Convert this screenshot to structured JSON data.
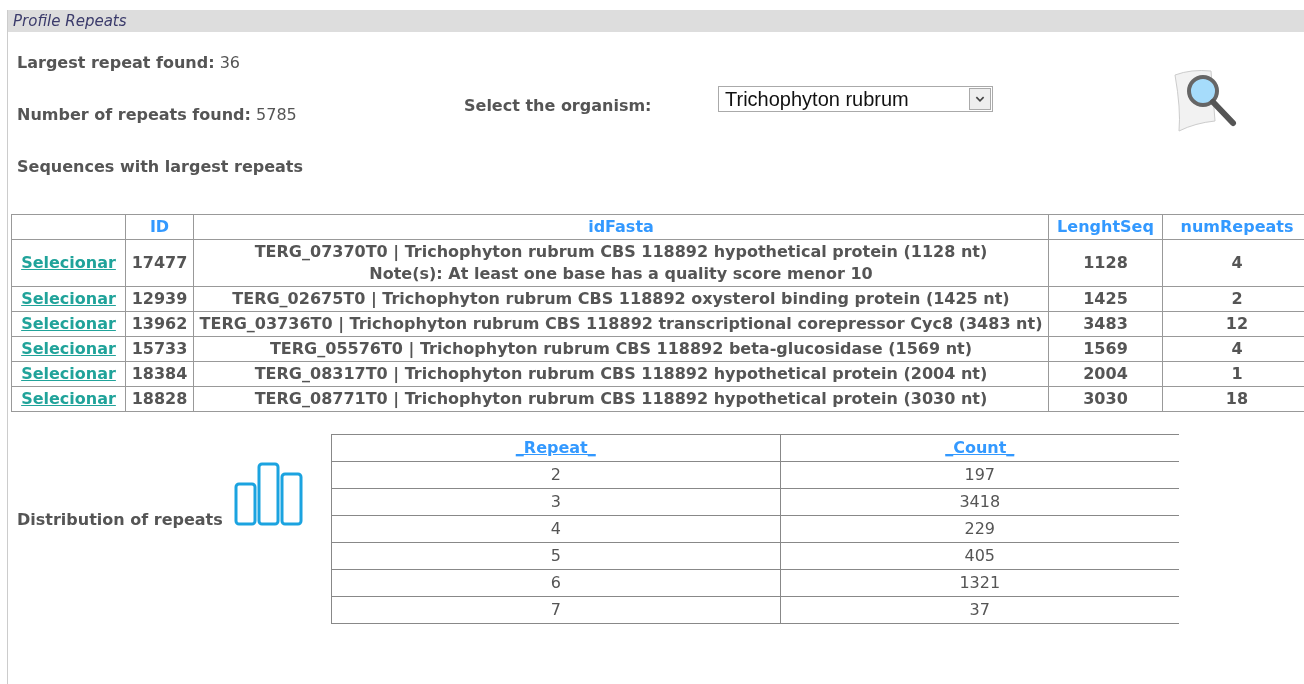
{
  "panel": {
    "title": "Profile Repeats"
  },
  "stats": [
    {
      "label": "Largest repeat found:",
      "value": "36"
    },
    {
      "label": "Number of repeats found:",
      "value": "5785"
    }
  ],
  "organism": {
    "label": "Select the organism:",
    "value": "Trichophyton rubrum"
  },
  "sequences": {
    "title": "Sequences with largest repeats",
    "columns": [
      "ID",
      "idFasta",
      "LenghtSeq",
      "numRepeats"
    ],
    "rows": [
      {
        "link": "Selecionar",
        "id": "17477",
        "description": "TERG_07370T0 | Trichophyton rubrum CBS 118892 hypothetical protein (1128 nt)",
        "note": "Note(s): At least one base has a quality score menor 10",
        "length": "1128",
        "repeats": "4"
      },
      {
        "link": "Selecionar",
        "id": "12939",
        "description": "TERG_02675T0 | Trichophyton rubrum CBS 118892 oxysterol binding protein (1425 nt)",
        "length": "1425",
        "repeats": "2"
      },
      {
        "link": "Selecionar",
        "id": "13962",
        "description": "TERG_03736T0 | Trichophyton rubrum CBS 118892 transcriptional corepressor Cyc8 (3483 nt)",
        "length": "3483",
        "repeats": "12"
      },
      {
        "link": "Selecionar",
        "id": "15733",
        "description": "TERG_05576T0 | Trichophyton rubrum CBS 118892 beta-glucosidase (1569 nt)",
        "length": "1569",
        "repeats": "4"
      },
      {
        "link": "Selecionar",
        "id": "18384",
        "description": "TERG_08317T0 | Trichophyton rubrum CBS 118892 hypothetical protein (2004 nt)",
        "length": "2004",
        "repeats": "1"
      },
      {
        "link": "Selecionar",
        "id": "18828",
        "description": "TERG_08771T0 | Trichophyton rubrum CBS 118892 hypothetical protein (3030 nt)",
        "length": "3030",
        "repeats": "18"
      }
    ]
  },
  "distribution": {
    "title": "Distribution of repeats",
    "columns": [
      "_Repeat_",
      "_Count_"
    ],
    "rows": [
      {
        "repeat": "2",
        "count": "197"
      },
      {
        "repeat": "3",
        "count": "3418"
      },
      {
        "repeat": "4",
        "count": "229"
      },
      {
        "repeat": "5",
        "count": "405"
      },
      {
        "repeat": "6",
        "count": "1321"
      },
      {
        "repeat": "7",
        "count": "37"
      }
    ]
  }
}
